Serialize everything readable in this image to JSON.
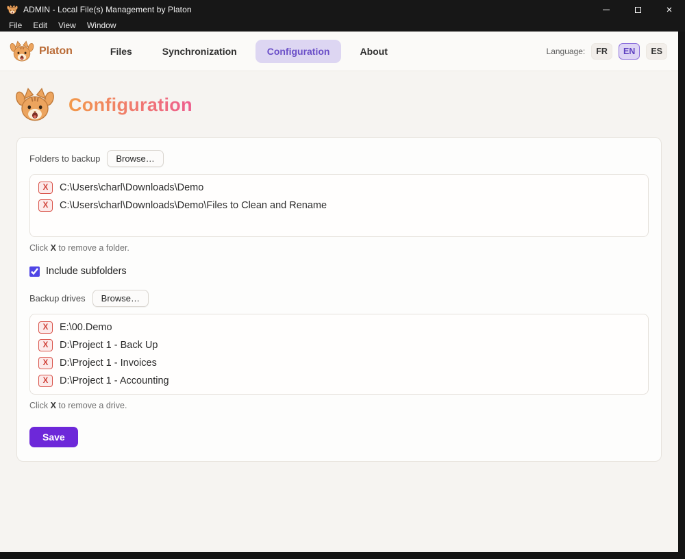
{
  "window": {
    "title": "ADMIN - Local File(s) Management by Platon",
    "controls": {
      "close": "×"
    }
  },
  "menu": {
    "items": [
      "File",
      "Edit",
      "View",
      "Window"
    ]
  },
  "header": {
    "brand": "Platon",
    "nav": [
      {
        "label": "Files",
        "active": false
      },
      {
        "label": "Synchronization",
        "active": false
      },
      {
        "label": "Configuration",
        "active": true
      },
      {
        "label": "About",
        "active": false
      }
    ],
    "language": {
      "label": "Language:",
      "options": [
        {
          "code": "FR",
          "active": false
        },
        {
          "code": "EN",
          "active": true
        },
        {
          "code": "ES",
          "active": false
        }
      ]
    }
  },
  "page": {
    "title": "Configuration"
  },
  "config": {
    "folders": {
      "label": "Folders to backup",
      "browse_label": "Browse…",
      "remove_symbol": "X",
      "items": [
        "C:\\Users\\charl\\Downloads\\Demo",
        "C:\\Users\\charl\\Downloads\\Demo\\Files to Clean and Rename"
      ],
      "hint_prefix": "Click ",
      "hint_bold": "X",
      "hint_suffix": " to remove a folder."
    },
    "subfolders": {
      "label": "Include subfolders",
      "checked": true
    },
    "drives": {
      "label": "Backup drives",
      "browse_label": "Browse…",
      "remove_symbol": "X",
      "items": [
        "E:\\00.Demo",
        "D:\\Project 1 - Back Up",
        "D:\\Project 1 - Invoices",
        "D:\\Project 1 - Accounting"
      ],
      "hint_prefix": "Click ",
      "hint_bold": "X",
      "hint_suffix": " to remove a drive."
    },
    "save_label": "Save"
  },
  "colors": {
    "titlebar_bg": "#171717",
    "accent_purple": "#6d28d9",
    "nav_active_bg": "#ddd6f2",
    "nav_active_text": "#6b4fc8",
    "brand_orange": "#b96a35",
    "heading_gradient_start": "#f2994a",
    "heading_gradient_end": "#ee5f8f",
    "remove_red": "#d9534a",
    "checkbox_accent": "#4f46e5"
  }
}
